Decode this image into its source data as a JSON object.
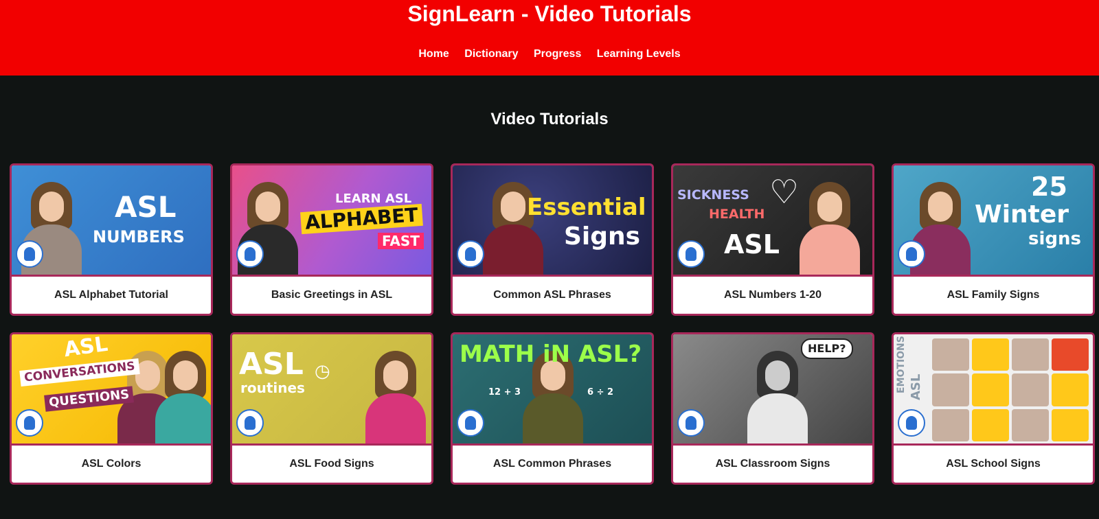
{
  "app": {
    "title": "SignLearn - Video Tutorials"
  },
  "nav": [
    {
      "label": "Home"
    },
    {
      "label": "Dictionary"
    },
    {
      "label": "Progress"
    },
    {
      "label": "Learning Levels"
    }
  ],
  "main": {
    "section_title": "Video Tutorials",
    "cards": [
      {
        "title": "ASL Alphabet Tutorial",
        "thumb_text_1": "ASL",
        "thumb_text_2": "NUMBERS"
      },
      {
        "title": "Basic Greetings in ASL",
        "thumb_text_1": "LEARN ASL",
        "thumb_text_2": "ALPHABET",
        "thumb_text_3": "FAST"
      },
      {
        "title": "Common ASL Phrases",
        "thumb_text_1": "Essential",
        "thumb_text_2": "Signs"
      },
      {
        "title": "ASL Numbers 1-20",
        "thumb_text_1": "SICKNESS",
        "thumb_text_2": "HEALTH",
        "thumb_text_3": "ASL"
      },
      {
        "title": "ASL Family Signs",
        "thumb_text_1": "25",
        "thumb_text_2": "Winter",
        "thumb_text_3": "signs"
      },
      {
        "title": "ASL Colors",
        "thumb_text_1": "ASL",
        "thumb_text_2": "CONVERSATIONS",
        "thumb_text_3": "QUESTIONS"
      },
      {
        "title": "ASL Food Signs",
        "thumb_text_1": "ASL",
        "thumb_text_2": "routines"
      },
      {
        "title": "ASL Common Phrases",
        "thumb_text_1": "MATH iN ASL?",
        "thumb_text_2": "12 + 3",
        "thumb_text_3": "6 ÷ 2"
      },
      {
        "title": "ASL Classroom Signs",
        "thumb_text_1": "HELP?"
      },
      {
        "title": "ASL School Signs",
        "thumb_text_1": "EMOTIONS",
        "thumb_text_2": "ASL"
      }
    ]
  },
  "colors": {
    "header_bg": "#f20000",
    "page_bg": "#101413",
    "card_border": "#a8285a"
  }
}
